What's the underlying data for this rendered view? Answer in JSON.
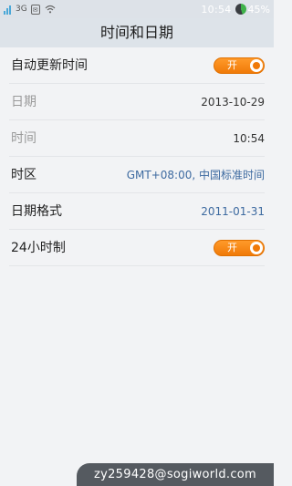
{
  "status_bar": {
    "network": "3G",
    "time": "10:54",
    "battery": "45%",
    "battery_level": 0.45
  },
  "header": {
    "title": "时间和日期"
  },
  "settings": {
    "auto_update": {
      "label": "自动更新时间",
      "toggle_label": "开",
      "state": "on"
    },
    "date": {
      "label": "日期",
      "value": "2013-10-29"
    },
    "time": {
      "label": "时间",
      "value": "10:54"
    },
    "timezone": {
      "label": "时区",
      "value": "GMT+08:00, 中国标准时间"
    },
    "date_format": {
      "label": "日期格式",
      "value": "2011-01-31"
    },
    "hour24": {
      "label": "24小时制",
      "toggle_label": "开",
      "state": "on"
    }
  },
  "watermark": "zy259428@sogiworld.com",
  "colors": {
    "toggle_on": "#f07a08",
    "link_blue": "#3d6aa0",
    "disabled_text": "#9a9a9a"
  }
}
